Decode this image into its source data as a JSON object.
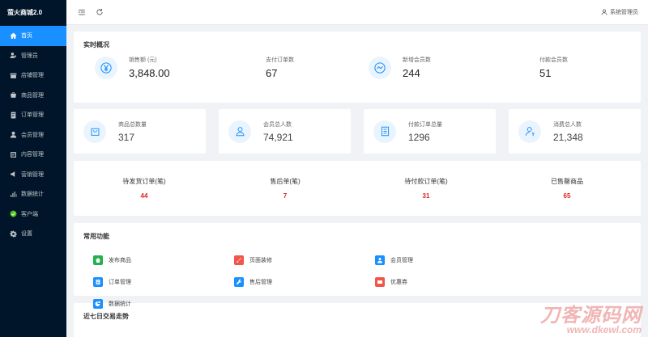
{
  "app": {
    "brand": "萤火商城2.0"
  },
  "sidebar": {
    "items": [
      {
        "label": "首页",
        "icon": "home-icon",
        "active": true
      },
      {
        "label": "管理员",
        "icon": "admin-icon"
      },
      {
        "label": "店铺管理",
        "icon": "store-icon"
      },
      {
        "label": "商品管理",
        "icon": "goods-icon"
      },
      {
        "label": "订单管理",
        "icon": "order-icon"
      },
      {
        "label": "会员管理",
        "icon": "user-icon"
      },
      {
        "label": "内容管理",
        "icon": "content-icon"
      },
      {
        "label": "营销管理",
        "icon": "marketing-icon"
      },
      {
        "label": "数据统计",
        "icon": "chart-icon"
      },
      {
        "label": "客户端",
        "icon": "client-icon"
      },
      {
        "label": "设置",
        "icon": "gear-icon"
      }
    ]
  },
  "topbar": {
    "user_label": "系统管理员"
  },
  "overview": {
    "title": "实时概况",
    "items": [
      {
        "label": "销售额 (元)",
        "value": "3,848.00"
      },
      {
        "label": "支付订单数",
        "value": "67"
      },
      {
        "label": "新增会员数",
        "value": "244"
      },
      {
        "label": "付款会员数",
        "value": "51"
      }
    ]
  },
  "stats": [
    {
      "label": "商品总数量",
      "value": "317"
    },
    {
      "label": "会员总人数",
      "value": "74,921"
    },
    {
      "label": "付款订单总量",
      "value": "1296"
    },
    {
      "label": "消费总人数",
      "value": "21,348"
    }
  ],
  "pending": [
    {
      "label": "待发货订单(笔)",
      "value": "44"
    },
    {
      "label": "售后单(笔)",
      "value": "7"
    },
    {
      "label": "待付款订单(笔)",
      "value": "31"
    },
    {
      "label": "已售罄商品",
      "value": "65"
    }
  ],
  "common": {
    "title": "常用功能",
    "items": [
      {
        "label": "发布商品",
        "color": "#22b14c"
      },
      {
        "label": "页面装修",
        "color": "#f0564a"
      },
      {
        "label": "会员管理",
        "color": "#1890ff"
      },
      {
        "label": "订单管理",
        "color": "#1890ff"
      },
      {
        "label": "售后管理",
        "color": "#1890ff"
      },
      {
        "label": "优惠券",
        "color": "#f0564a"
      },
      {
        "label": "数据统计",
        "color": "#1890ff"
      }
    ]
  },
  "trend": {
    "title": "近七日交易走势"
  },
  "watermark": {
    "main": "刀客源码网",
    "sub": "www.dkewl.com"
  }
}
